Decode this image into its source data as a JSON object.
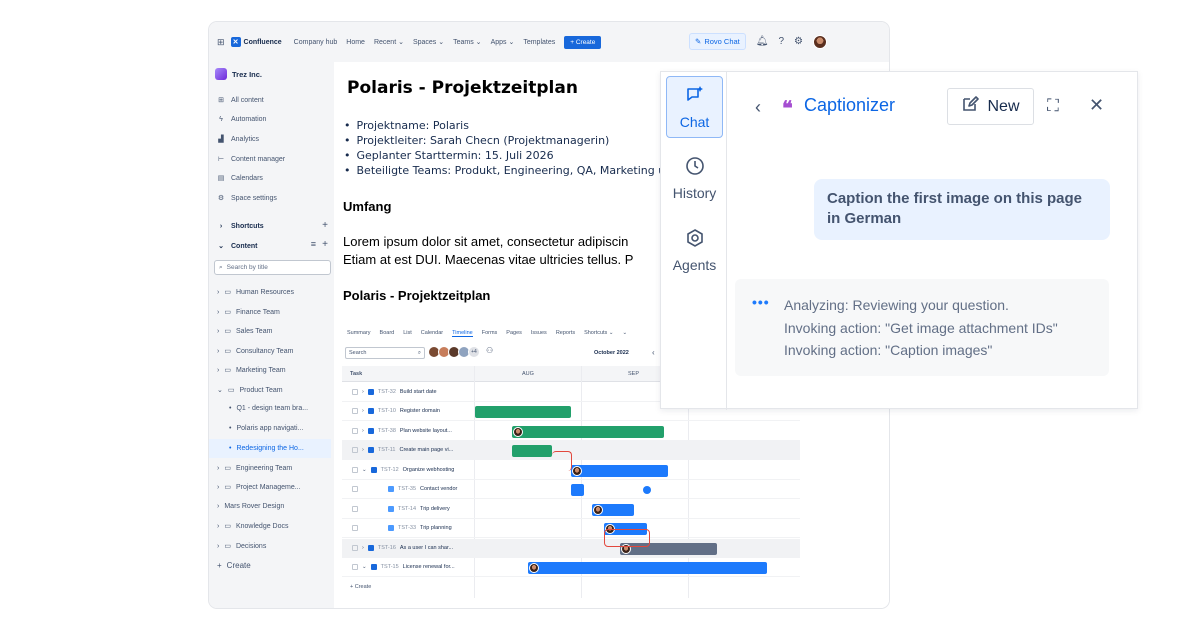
{
  "topnav": {
    "brand": "Confluence",
    "items": [
      "Company hub",
      "Home",
      "Recent ⌄",
      "Spaces ⌄",
      "Teams ⌄",
      "Apps ⌄",
      "Templates"
    ],
    "create": "+ Create",
    "rovo": "Rovo Chat"
  },
  "sidebar": {
    "space": "Trez Inc.",
    "menu": [
      "All content",
      "Automation",
      "Analytics",
      "Content manager",
      "Calendars",
      "Space settings"
    ],
    "shortcuts": "Shortcuts",
    "content": "Content",
    "search_placeholder": "Search by title",
    "tree": [
      "Human Resources",
      "Finance Team",
      "Sales Team",
      "Consultancy Team",
      "Marketing Team",
      "Product Team",
      "Q1 - design team bra...",
      "Polaris app navigati...",
      "Redesigning the Ho...",
      "Engineering Team",
      "Project Manageme...",
      "Mars Rover Design",
      "Knowledge Docs",
      "Decisions"
    ],
    "create": "Create"
  },
  "doc": {
    "title": "Polaris - Projektzeitplan",
    "bullets": [
      "Projektname: Polaris",
      "Projektleiter: Sarah Checn (Projektmanagerin)",
      "Geplanter Starttermin: 15. Juli 2026",
      "Beteiligte Teams: Produkt, Engineering, QA, Marketing und Su"
    ],
    "umfang": "Umfang",
    "lorem1": "Lorem ipsum dolor sit amet, consectetur adipiscin",
    "lorem2": "Etiam at est DUI. Maecenas vitae ultricies tellus. P",
    "heading2": "Polaris - Projektzeitplan"
  },
  "timeline": {
    "tabs": [
      "Summary",
      "Board",
      "List",
      "Calendar",
      "Timeline",
      "Forms",
      "Pages",
      "Issues",
      "Reports",
      "Shortcuts ⌄",
      "⌄"
    ],
    "search": "Search",
    "more": "+4",
    "month": "October 2022",
    "col_task": "Task",
    "col_aug": "AUG",
    "col_sep": "SEP",
    "rows": [
      {
        "key": "TST-32",
        "name": "Build start date"
      },
      {
        "key": "TST-10",
        "name": "Register domain"
      },
      {
        "key": "TST-38",
        "name": "Plan website layout..."
      },
      {
        "key": "TST-11",
        "name": "Create main page vi..."
      },
      {
        "key": "TST-12",
        "name": "Organize webhosting"
      },
      {
        "key": "TST-35",
        "name": "Contact vendor"
      },
      {
        "key": "TST-14",
        "name": "Trip delivery"
      },
      {
        "key": "TST-33",
        "name": "Trip planning"
      },
      {
        "key": "TST-16",
        "name": "As a user I can shar..."
      },
      {
        "key": "TST-15",
        "name": "License renewal for..."
      }
    ],
    "create": "+ Create"
  },
  "panel": {
    "rail": [
      {
        "label": "Chat",
        "icon": "chat-sparkle-icon"
      },
      {
        "label": "History",
        "icon": "clock-icon"
      },
      {
        "label": "Agents",
        "icon": "agent-icon"
      }
    ],
    "title": "Captionizer",
    "new_label": "New",
    "user_message": "Caption the first image on this page in German",
    "status": [
      "Analyzing: Reviewing your question.",
      "Invoking action: \"Get image attachment IDs\"",
      "Invoking action: \"Caption images\""
    ]
  }
}
